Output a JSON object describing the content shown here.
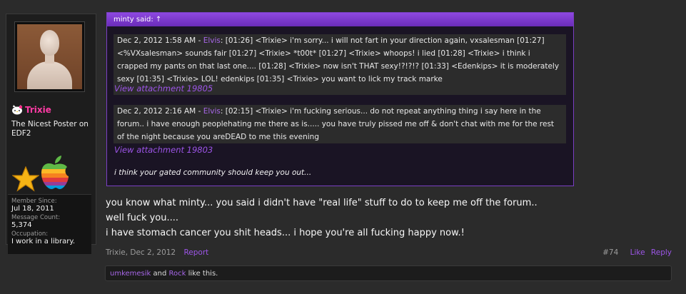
{
  "user": {
    "name": "Trixie",
    "title": "The Nicest Poster on EDF2",
    "stats": {
      "member_since_label": "Member Since:",
      "member_since": "Jul 18, 2011",
      "message_count_label": "Message Count:",
      "message_count": "5,374",
      "occupation_label": "Occupation:",
      "occupation": "I work in a library."
    }
  },
  "quote": {
    "header": "minty said:",
    "header_arrow": "↑",
    "chat1_time": "Dec 2, 2012 1:58 AM - ",
    "chat1_name": "Elvis",
    "chat1_text": ": [01:26] <Trixie> i'm sorry... i will not fart in your direction again, vxsalesman [01:27] <%VXsalesman> sounds fair [01:27] <Trixie> *t00t* [01:27] <Trixie> whoops! i lied [01:28] <Trixie> i think i crapped my pants on that last one.... [01:28] <Trixie> now isn't THAT sexy!?!?!? [01:33] <Edenkips> it is moderately sexy [01:35] <Trixie> LOL! edenkips [01:35] <Trixie> you want to lick my track marke",
    "attachment1": "View attachment 19805",
    "chat2_time": "Dec 2, 2012 2:16 AM - ",
    "chat2_name": "Elvis",
    "chat2_text": ": [02:15] <Trixie> i'm fucking serious... do not repeat anything thing i say here in the forum.. i have enough peoplehating me there as is..... you have truly pissed me off & don't chat with me for the rest of the night because you areDEAD to me this evening",
    "attachment2": "View attachment 19803",
    "text": "i think your gated community should keep you out..."
  },
  "message": {
    "line1": "you know what minty... you said i didn't have \"real life\" stuff to do to keep me off the forum..",
    "line2": "well fuck you....",
    "line3": "i have stomach cancer you shit heads... i hope you're all fucking happy now.!"
  },
  "footer": {
    "author_date": "Trixie, Dec 2, 2012",
    "report": "Report",
    "post_number": "#74",
    "like": "Like",
    "reply": "Reply"
  },
  "likes": {
    "user1": "umkemesik",
    "and": " and ",
    "user2": "Rock",
    "suffix": " like this."
  }
}
